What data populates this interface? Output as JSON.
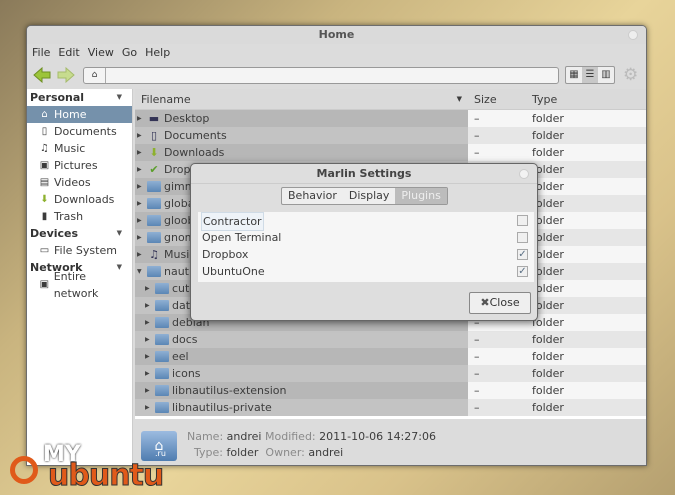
{
  "window": {
    "title": "Home"
  },
  "menu": [
    "File",
    "Edit",
    "View",
    "Go",
    "Help"
  ],
  "sidebar": {
    "sections": [
      {
        "label": "Personal",
        "items": [
          "Home",
          "Documents",
          "Music",
          "Pictures",
          "Videos",
          "Downloads",
          "Trash"
        ]
      },
      {
        "label": "Devices",
        "items": [
          "File System"
        ]
      },
      {
        "label": "Network",
        "items": [
          "Entire network"
        ]
      }
    ]
  },
  "list": {
    "headers": {
      "filename": "Filename",
      "size": "Size",
      "type": "Type"
    },
    "rows": [
      {
        "name": "Desktop",
        "size": "–",
        "type": "folder",
        "indent": 0,
        "icon": "desktop-icon"
      },
      {
        "name": "Documents",
        "size": "–",
        "type": "folder",
        "indent": 0,
        "icon": "documents-icon"
      },
      {
        "name": "Downloads",
        "size": "–",
        "type": "folder",
        "indent": 0,
        "icon": "downloads-icon"
      },
      {
        "name": "Dropb",
        "size": "–",
        "type": "folder",
        "indent": 0,
        "icon": "dropbox-icon"
      },
      {
        "name": "gimmi",
        "size": "–",
        "type": "folder",
        "indent": 0,
        "icon": "folder-icon"
      },
      {
        "name": "global",
        "size": "–",
        "type": "folder",
        "indent": 0,
        "icon": "folder-icon"
      },
      {
        "name": "gloob",
        "size": "–",
        "type": "folder",
        "indent": 0,
        "icon": "folder-icon"
      },
      {
        "name": "gnom",
        "size": "–",
        "type": "folder",
        "indent": 0,
        "icon": "folder-icon"
      },
      {
        "name": "Music",
        "size": "–",
        "type": "folder",
        "indent": 0,
        "icon": "music-icon"
      },
      {
        "name": "nautil",
        "size": "–",
        "type": "folder",
        "indent": 0,
        "icon": "folder-icon",
        "expanded": true
      },
      {
        "name": "cut-n",
        "size": "–",
        "type": "folder",
        "indent": 1,
        "icon": "folder-icon"
      },
      {
        "name": "data",
        "size": "–",
        "type": "folder",
        "indent": 1,
        "icon": "folder-icon"
      },
      {
        "name": "debian",
        "size": "–",
        "type": "folder",
        "indent": 1,
        "icon": "folder-icon"
      },
      {
        "name": "docs",
        "size": "–",
        "type": "folder",
        "indent": 1,
        "icon": "folder-icon"
      },
      {
        "name": "eel",
        "size": "–",
        "type": "folder",
        "indent": 1,
        "icon": "folder-icon"
      },
      {
        "name": "icons",
        "size": "–",
        "type": "folder",
        "indent": 1,
        "icon": "folder-icon"
      },
      {
        "name": "libnautilus-extension",
        "size": "–",
        "type": "folder",
        "indent": 1,
        "icon": "folder-icon"
      },
      {
        "name": "libnautilus-private",
        "size": "–",
        "type": "folder",
        "indent": 1,
        "icon": "folder-icon"
      }
    ]
  },
  "footer": {
    "name_label": "Name:",
    "name": "andrei",
    "modified_label": "Modified:",
    "modified": "2011-10-06 14:27:06",
    "type_label": "Type:",
    "type": "folder",
    "owner_label": "Owner:",
    "owner": "andrei",
    "icon_badge": ".ru"
  },
  "dialog": {
    "title": "Marlin Settings",
    "tabs": [
      "Behavior",
      "Display",
      "Plugins"
    ],
    "active_tab": "Plugins",
    "plugins": [
      {
        "name": "Contractor",
        "checked": false
      },
      {
        "name": "Open Terminal",
        "checked": false
      },
      {
        "name": "Dropbox",
        "checked": true
      },
      {
        "name": "UbuntuOne",
        "checked": true
      }
    ],
    "close_label": "Close"
  },
  "watermark": {
    "line1": "MY",
    "line2": "ubuntu"
  }
}
